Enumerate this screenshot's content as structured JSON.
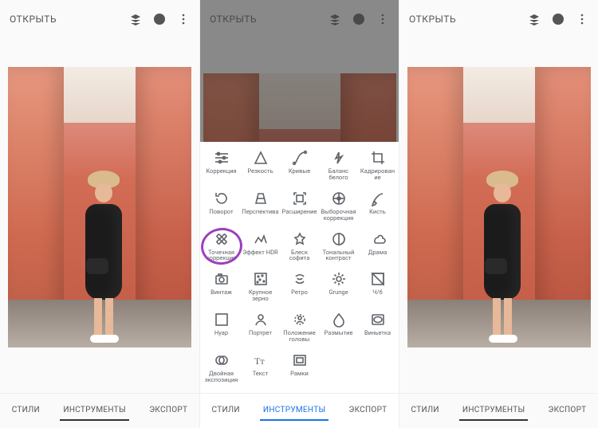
{
  "header": {
    "open": "ОТКРЫТЬ"
  },
  "tabs": {
    "styles": "СТИЛИ",
    "tools": "ИНСТРУМЕНТЫ",
    "export": "ЭКСПОРТ"
  },
  "tools": [
    {
      "id": "tune",
      "label": "Коррекция"
    },
    {
      "id": "details",
      "label": "Резкость"
    },
    {
      "id": "curves",
      "label": "Кривые"
    },
    {
      "id": "wb",
      "label": "Баланс белого"
    },
    {
      "id": "crop",
      "label": "Кадрирование"
    },
    {
      "id": "rotate",
      "label": "Поворот"
    },
    {
      "id": "perspective",
      "label": "Перспектива"
    },
    {
      "id": "expand",
      "label": "Расширение"
    },
    {
      "id": "selective",
      "label": "Выборочная коррекция"
    },
    {
      "id": "brush",
      "label": "Кисть"
    },
    {
      "id": "healing",
      "label": "Точечная коррекция"
    },
    {
      "id": "hdr",
      "label": "Эффект HDR"
    },
    {
      "id": "glamour",
      "label": "Блеск софита"
    },
    {
      "id": "tonal",
      "label": "Тональный контраст"
    },
    {
      "id": "drama",
      "label": "Драма"
    },
    {
      "id": "vintage",
      "label": "Винтаж"
    },
    {
      "id": "grainy",
      "label": "Крупное зерно"
    },
    {
      "id": "retrolux",
      "label": "Ретро"
    },
    {
      "id": "grunge",
      "label": "Grunge"
    },
    {
      "id": "bw",
      "label": "Ч/б"
    },
    {
      "id": "noir",
      "label": "Нуар"
    },
    {
      "id": "portrait",
      "label": "Портрет"
    },
    {
      "id": "headpose",
      "label": "Положение головы"
    },
    {
      "id": "blur",
      "label": "Размытие"
    },
    {
      "id": "vignette",
      "label": "Виньетка"
    },
    {
      "id": "dblexp",
      "label": "Двойная экспозиция"
    },
    {
      "id": "text",
      "label": "Текст"
    },
    {
      "id": "frames",
      "label": "Рамки"
    }
  ],
  "highlight_tool_id": "healing",
  "colors": {
    "accent_blue": "#1a73e8",
    "highlight": "#9c3fbf"
  }
}
